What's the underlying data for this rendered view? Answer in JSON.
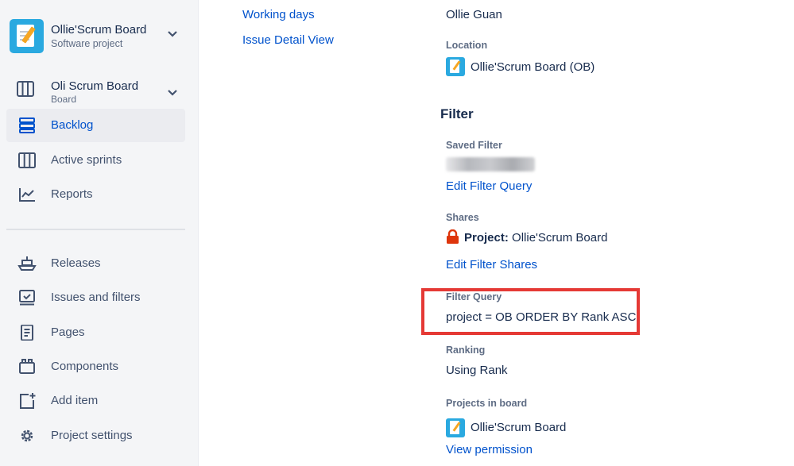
{
  "sidebar": {
    "project_name": "Ollie'Scrum Board",
    "project_type": "Software project",
    "board_name": "Oli Scrum Board",
    "board_type": "Board",
    "nav_primary": [
      {
        "label": "Backlog",
        "icon": "backlog-icon",
        "active": true
      },
      {
        "label": "Active sprints",
        "icon": "active-sprints-icon",
        "active": false
      },
      {
        "label": "Reports",
        "icon": "reports-icon",
        "active": false
      }
    ],
    "nav_secondary": [
      {
        "label": "Releases",
        "icon": "releases-icon"
      },
      {
        "label": "Issues and filters",
        "icon": "issues-filters-icon"
      },
      {
        "label": "Pages",
        "icon": "pages-icon"
      },
      {
        "label": "Components",
        "icon": "components-icon"
      },
      {
        "label": "Add item",
        "icon": "add-item-icon"
      },
      {
        "label": "Project settings",
        "icon": "gear-icon"
      }
    ]
  },
  "settings_nav": {
    "working_days": "Working days",
    "issue_detail_view": "Issue Detail View"
  },
  "details": {
    "admin_name": "Ollie Guan",
    "location_label": "Location",
    "location_value": "Ollie'Scrum Board (OB)",
    "filter_heading": "Filter",
    "saved_filter_label": "Saved Filter",
    "edit_filter_query": "Edit Filter Query",
    "shares_label": "Shares",
    "shares_prefix": "Project:",
    "shares_value": "Ollie'Scrum Board",
    "edit_filter_shares": "Edit Filter Shares",
    "filter_query_label": "Filter Query",
    "filter_query_value": "project = OB ORDER BY Rank ASC",
    "ranking_label": "Ranking",
    "ranking_value": "Using Rank",
    "projects_label": "Projects in board",
    "projects_value": "Ollie'Scrum Board",
    "view_permission": "View permission"
  },
  "colors": {
    "link": "#0052cc",
    "highlight_border": "#e53935",
    "lock": "#de350b",
    "project_icon": "#2aa9e0"
  }
}
